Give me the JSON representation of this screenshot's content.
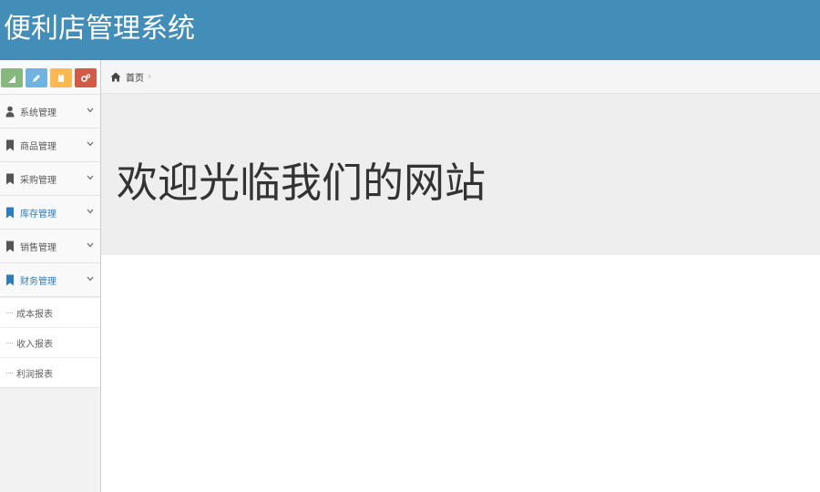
{
  "header": {
    "title": "便利店管理系统"
  },
  "shortcuts": [
    {
      "icon": "signal-icon",
      "color": "#87b87f"
    },
    {
      "icon": "pencil-icon",
      "color": "#6fb3e0"
    },
    {
      "icon": "users-icon",
      "color": "#ffb752"
    },
    {
      "icon": "cogs-icon",
      "color": "#d15b47"
    }
  ],
  "sidebar": {
    "items": [
      {
        "label": "系统管理",
        "icon": "user-icon",
        "active": false
      },
      {
        "label": "商品管理",
        "icon": "bookmark-icon",
        "active": false
      },
      {
        "label": "采购管理",
        "icon": "bookmark-icon",
        "active": false
      },
      {
        "label": "库存管理",
        "icon": "bookmark-icon",
        "active": true
      },
      {
        "label": "销售管理",
        "icon": "bookmark-icon",
        "active": false
      },
      {
        "label": "财务管理",
        "icon": "bookmark-icon",
        "active": true
      }
    ],
    "submenu": [
      {
        "label": "成本报表"
      },
      {
        "label": "收入报表"
      },
      {
        "label": "利润报表"
      }
    ]
  },
  "breadcrumb": {
    "home_label": "首页",
    "separator": "›"
  },
  "main": {
    "welcome": "欢迎光临我们的网站"
  },
  "colors": {
    "header_bg": "#438eb9",
    "active_text": "#2b7dbc",
    "jumbotron_bg": "#eeeeee"
  }
}
